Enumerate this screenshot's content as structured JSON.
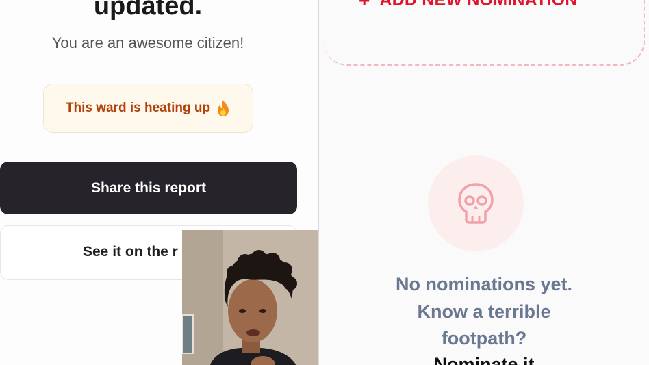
{
  "left": {
    "headline": "updated.",
    "subtitle": "You are an awesome citizen!",
    "badge": {
      "label": "This ward is heating up",
      "icon": "flame-icon"
    },
    "share_button": "Share this report",
    "map_button": "See it on the r"
  },
  "right": {
    "add_nomination": {
      "icon": "plus-icon",
      "label": "ADD NEW NOMINATION"
    },
    "empty_state": {
      "icon": "skull-icon",
      "line1": "No nominations yet.",
      "line2": "Know a terrible",
      "line3": "footpath?",
      "cta": "Nominate it"
    }
  },
  "colors": {
    "accent_red": "#e0142b",
    "dark_button": "#26242a",
    "badge_text": "#b0420c",
    "badge_bg": "#fff8ec",
    "empty_text": "#6b7891"
  }
}
